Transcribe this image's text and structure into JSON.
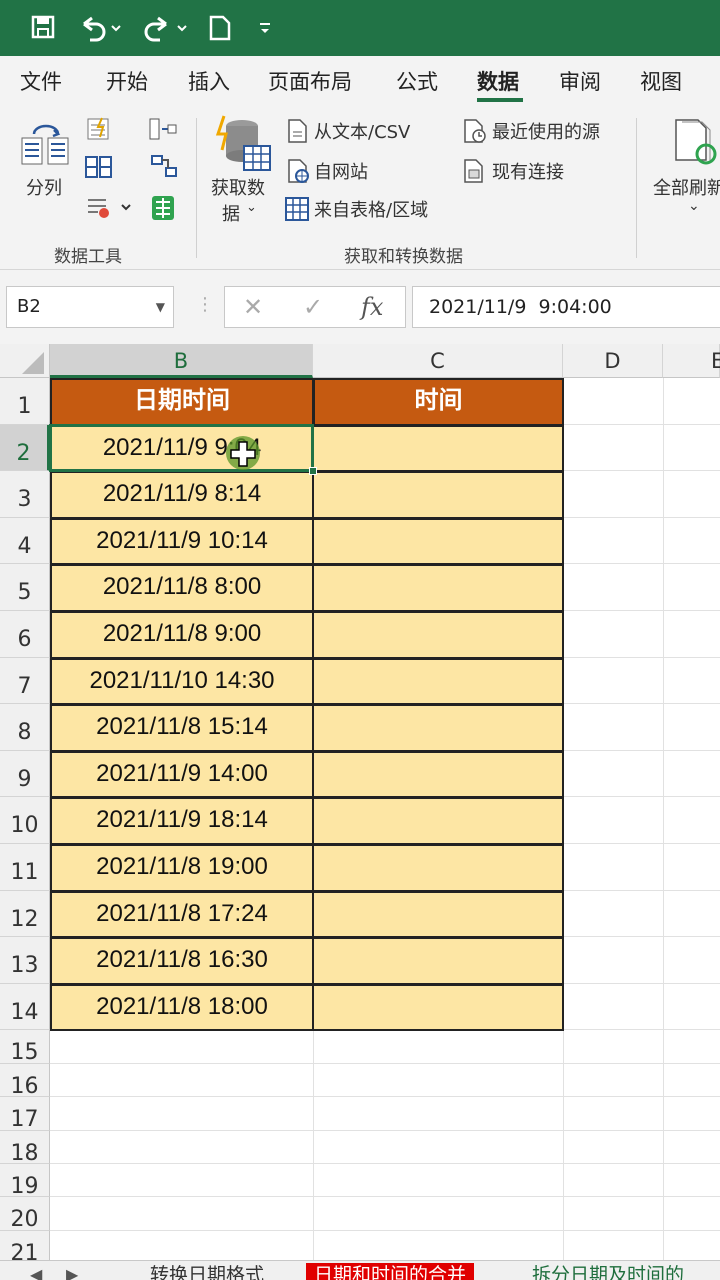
{
  "ribbon_tabs": [
    "文件",
    "开始",
    "插入",
    "页面布局",
    "公式",
    "数据",
    "审阅",
    "视图"
  ],
  "active_tab": "数据",
  "ribbon": {
    "split_label": "分列",
    "group_data_tools": "数据工具",
    "get_data_label1": "获取数",
    "get_data_label2": "据",
    "from_text_csv": "从文本/CSV",
    "from_web": "自网站",
    "from_table": "来自表格/区域",
    "recent_sources": "最近使用的源",
    "existing_connections": "现有连接",
    "group_get_transform": "获取和转换数据",
    "refresh_all": "全部刷新"
  },
  "formula_bar": {
    "name_box": "B2",
    "cancel": "✕",
    "enter": "✓",
    "fx": "fx",
    "value": "2021/11/9  9:04:00"
  },
  "columns": [
    "B",
    "C",
    "D",
    "E"
  ],
  "selected_column": "B",
  "rows": [
    "1",
    "2",
    "3",
    "4",
    "5",
    "6",
    "7",
    "8",
    "9",
    "10",
    "11",
    "12",
    "13",
    "14",
    "15",
    "16",
    "17",
    "18",
    "19",
    "20",
    "21"
  ],
  "selected_row": "2",
  "table": {
    "headers": [
      "日期时间",
      "时间"
    ],
    "datetimes": [
      "2021/11/9 9:04",
      "2021/11/9 8:14",
      "2021/11/9 10:14",
      "2021/11/8 8:00",
      "2021/11/8 9:00",
      "2021/11/10 14:30",
      "2021/11/8 15:14",
      "2021/11/9 14:00",
      "2021/11/9 18:14",
      "2021/11/8 19:00",
      "2021/11/8 17:24",
      "2021/11/8 16:30",
      "2021/11/8 18:00"
    ]
  },
  "sheet_tabs": [
    "转换日期格式",
    "日期和时间的合并",
    "拆分日期及时间的"
  ],
  "active_sheet": "日期和时间的合并",
  "colors": {
    "excel_green": "#217346",
    "header_fill": "#c55a11",
    "data_fill": "#fde6a4",
    "active_sheet_tab": "#e00000"
  }
}
